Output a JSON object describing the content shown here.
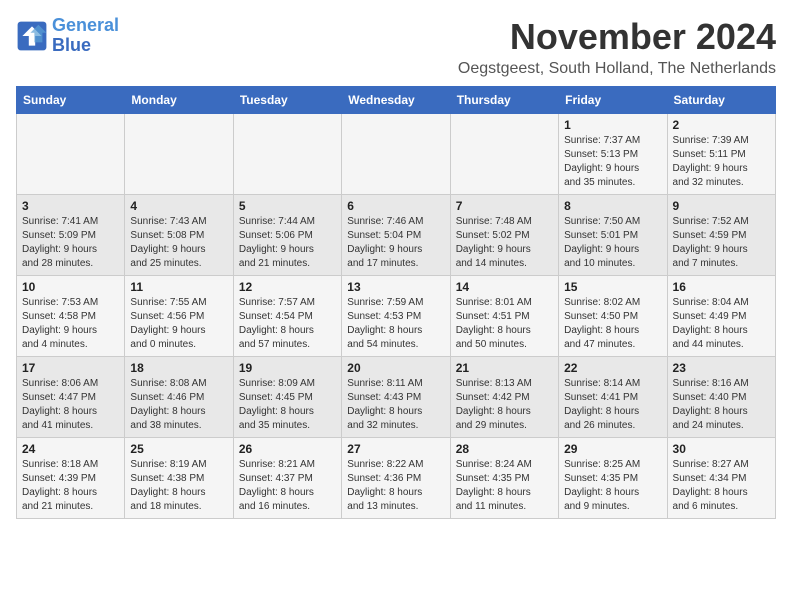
{
  "logo": {
    "line1": "General",
    "line2": "Blue"
  },
  "title": "November 2024",
  "subtitle": "Oegstgeest, South Holland, The Netherlands",
  "weekdays": [
    "Sunday",
    "Monday",
    "Tuesday",
    "Wednesday",
    "Thursday",
    "Friday",
    "Saturday"
  ],
  "weeks": [
    [
      {
        "day": "",
        "detail": ""
      },
      {
        "day": "",
        "detail": ""
      },
      {
        "day": "",
        "detail": ""
      },
      {
        "day": "",
        "detail": ""
      },
      {
        "day": "",
        "detail": ""
      },
      {
        "day": "1",
        "detail": "Sunrise: 7:37 AM\nSunset: 5:13 PM\nDaylight: 9 hours\nand 35 minutes."
      },
      {
        "day": "2",
        "detail": "Sunrise: 7:39 AM\nSunset: 5:11 PM\nDaylight: 9 hours\nand 32 minutes."
      }
    ],
    [
      {
        "day": "3",
        "detail": "Sunrise: 7:41 AM\nSunset: 5:09 PM\nDaylight: 9 hours\nand 28 minutes."
      },
      {
        "day": "4",
        "detail": "Sunrise: 7:43 AM\nSunset: 5:08 PM\nDaylight: 9 hours\nand 25 minutes."
      },
      {
        "day": "5",
        "detail": "Sunrise: 7:44 AM\nSunset: 5:06 PM\nDaylight: 9 hours\nand 21 minutes."
      },
      {
        "day": "6",
        "detail": "Sunrise: 7:46 AM\nSunset: 5:04 PM\nDaylight: 9 hours\nand 17 minutes."
      },
      {
        "day": "7",
        "detail": "Sunrise: 7:48 AM\nSunset: 5:02 PM\nDaylight: 9 hours\nand 14 minutes."
      },
      {
        "day": "8",
        "detail": "Sunrise: 7:50 AM\nSunset: 5:01 PM\nDaylight: 9 hours\nand 10 minutes."
      },
      {
        "day": "9",
        "detail": "Sunrise: 7:52 AM\nSunset: 4:59 PM\nDaylight: 9 hours\nand 7 minutes."
      }
    ],
    [
      {
        "day": "10",
        "detail": "Sunrise: 7:53 AM\nSunset: 4:58 PM\nDaylight: 9 hours\nand 4 minutes."
      },
      {
        "day": "11",
        "detail": "Sunrise: 7:55 AM\nSunset: 4:56 PM\nDaylight: 9 hours\nand 0 minutes."
      },
      {
        "day": "12",
        "detail": "Sunrise: 7:57 AM\nSunset: 4:54 PM\nDaylight: 8 hours\nand 57 minutes."
      },
      {
        "day": "13",
        "detail": "Sunrise: 7:59 AM\nSunset: 4:53 PM\nDaylight: 8 hours\nand 54 minutes."
      },
      {
        "day": "14",
        "detail": "Sunrise: 8:01 AM\nSunset: 4:51 PM\nDaylight: 8 hours\nand 50 minutes."
      },
      {
        "day": "15",
        "detail": "Sunrise: 8:02 AM\nSunset: 4:50 PM\nDaylight: 8 hours\nand 47 minutes."
      },
      {
        "day": "16",
        "detail": "Sunrise: 8:04 AM\nSunset: 4:49 PM\nDaylight: 8 hours\nand 44 minutes."
      }
    ],
    [
      {
        "day": "17",
        "detail": "Sunrise: 8:06 AM\nSunset: 4:47 PM\nDaylight: 8 hours\nand 41 minutes."
      },
      {
        "day": "18",
        "detail": "Sunrise: 8:08 AM\nSunset: 4:46 PM\nDaylight: 8 hours\nand 38 minutes."
      },
      {
        "day": "19",
        "detail": "Sunrise: 8:09 AM\nSunset: 4:45 PM\nDaylight: 8 hours\nand 35 minutes."
      },
      {
        "day": "20",
        "detail": "Sunrise: 8:11 AM\nSunset: 4:43 PM\nDaylight: 8 hours\nand 32 minutes."
      },
      {
        "day": "21",
        "detail": "Sunrise: 8:13 AM\nSunset: 4:42 PM\nDaylight: 8 hours\nand 29 minutes."
      },
      {
        "day": "22",
        "detail": "Sunrise: 8:14 AM\nSunset: 4:41 PM\nDaylight: 8 hours\nand 26 minutes."
      },
      {
        "day": "23",
        "detail": "Sunrise: 8:16 AM\nSunset: 4:40 PM\nDaylight: 8 hours\nand 24 minutes."
      }
    ],
    [
      {
        "day": "24",
        "detail": "Sunrise: 8:18 AM\nSunset: 4:39 PM\nDaylight: 8 hours\nand 21 minutes."
      },
      {
        "day": "25",
        "detail": "Sunrise: 8:19 AM\nSunset: 4:38 PM\nDaylight: 8 hours\nand 18 minutes."
      },
      {
        "day": "26",
        "detail": "Sunrise: 8:21 AM\nSunset: 4:37 PM\nDaylight: 8 hours\nand 16 minutes."
      },
      {
        "day": "27",
        "detail": "Sunrise: 8:22 AM\nSunset: 4:36 PM\nDaylight: 8 hours\nand 13 minutes."
      },
      {
        "day": "28",
        "detail": "Sunrise: 8:24 AM\nSunset: 4:35 PM\nDaylight: 8 hours\nand 11 minutes."
      },
      {
        "day": "29",
        "detail": "Sunrise: 8:25 AM\nSunset: 4:35 PM\nDaylight: 8 hours\nand 9 minutes."
      },
      {
        "day": "30",
        "detail": "Sunrise: 8:27 AM\nSunset: 4:34 PM\nDaylight: 8 hours\nand 6 minutes."
      }
    ]
  ]
}
